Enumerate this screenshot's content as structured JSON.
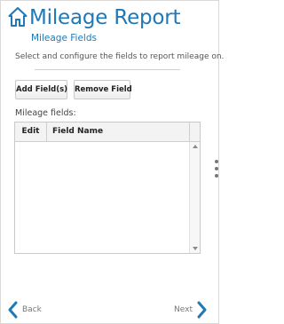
{
  "header": {
    "title": "Mileage Report",
    "subtitle": "Mileage Fields",
    "icon": "home-icon",
    "accent_color": "#1f78b7"
  },
  "instructions": "Select and configure the fields to report mileage on.",
  "toolbar": {
    "add_label": "Add Field(s)",
    "remove_label": "Remove Field"
  },
  "fields": {
    "label": "Mileage fields:",
    "columns": [
      "Edit",
      "Field Name"
    ],
    "rows": []
  },
  "navigation": {
    "back_label": "Back",
    "next_label": "Next",
    "chevron_color": "#1f78b7"
  }
}
